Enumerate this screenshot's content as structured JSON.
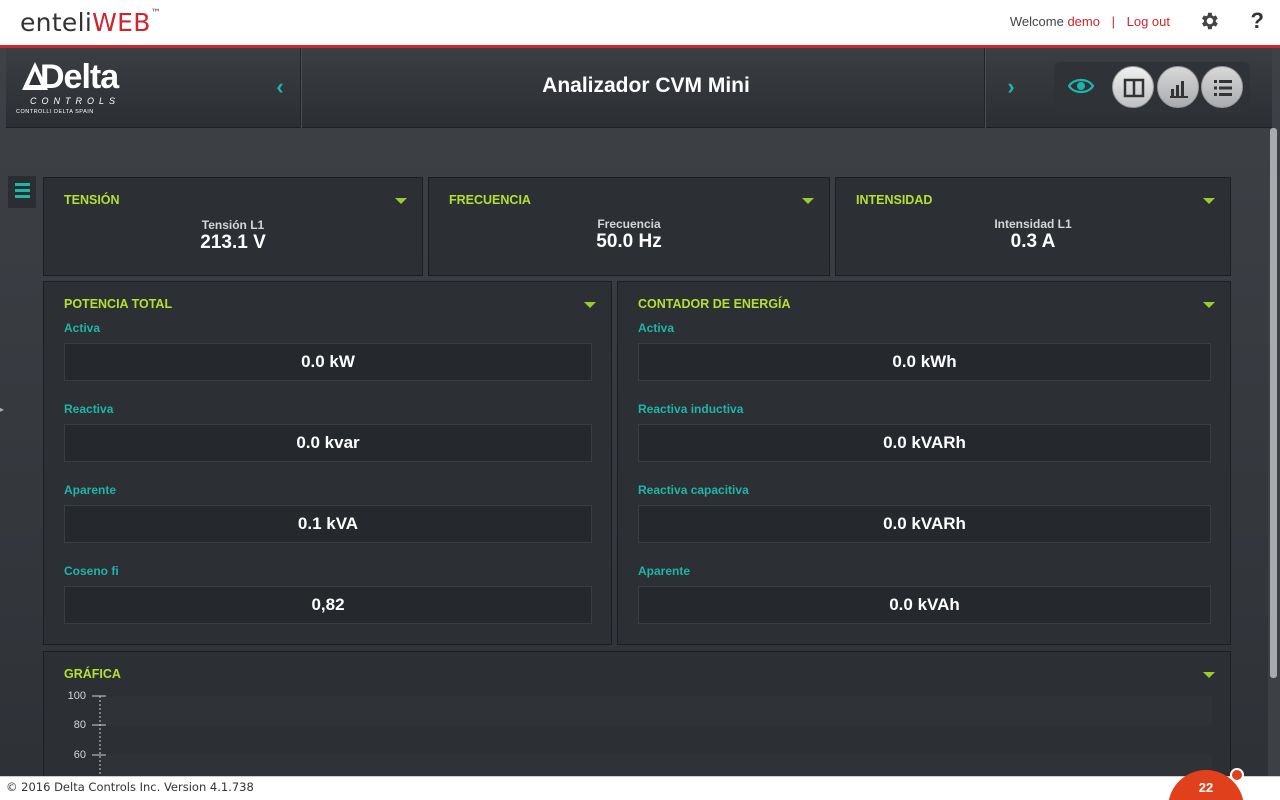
{
  "header": {
    "brand_plain": "enteli",
    "brand_accent": "WEB",
    "brand_tm": "™",
    "welcome": "Welcome",
    "username": "demo",
    "separator": "|",
    "logout": "Log out",
    "help": "?"
  },
  "nav": {
    "logo_main": "Delta",
    "logo_sub": "CONTROLS",
    "logo_tagline": "CONTROLLI DELTA SPAIN",
    "title": "Analizador CVM Mini",
    "prev": "‹",
    "next": "›"
  },
  "panels": {
    "tension": {
      "title": "TENSIÓN",
      "label": "Tensión L1",
      "value": "213.1 V"
    },
    "frecuencia": {
      "title": "FRECUENCIA",
      "label": "Frecuencia",
      "value": "50.0 Hz"
    },
    "intensidad": {
      "title": "INTENSIDAD",
      "label": "Intensidad L1",
      "value": "0.3 A"
    },
    "potencia": {
      "title": "POTENCIA TOTAL",
      "fields": [
        {
          "label": "Activa",
          "value": "0.0 kW"
        },
        {
          "label": "Reactiva",
          "value": "0.0 kvar"
        },
        {
          "label": "Aparente",
          "value": "0.1 kVA"
        },
        {
          "label": "Coseno fi",
          "value": "0,82"
        }
      ]
    },
    "energia": {
      "title": "CONTADOR DE ENERGÍA",
      "fields": [
        {
          "label": "Activa",
          "value": "0.0 kWh"
        },
        {
          "label": "Reactiva inductiva",
          "value": "0.0 kVARh"
        },
        {
          "label": "Reactiva capacitiva",
          "value": "0.0 kVARh"
        },
        {
          "label": "Aparente",
          "value": "0.0 kVAh"
        }
      ]
    },
    "grafica": {
      "title": "GRÁFICA",
      "y_ticks": [
        "100",
        "80",
        "60"
      ]
    }
  },
  "footer": {
    "copyright": "© 2016 Delta Controls Inc. Version 4.1.738",
    "badge_count": "22"
  },
  "colors": {
    "accent_red": "#d0252e",
    "panel_title_green": "#b5e033",
    "teal": "#1fb5a8"
  }
}
